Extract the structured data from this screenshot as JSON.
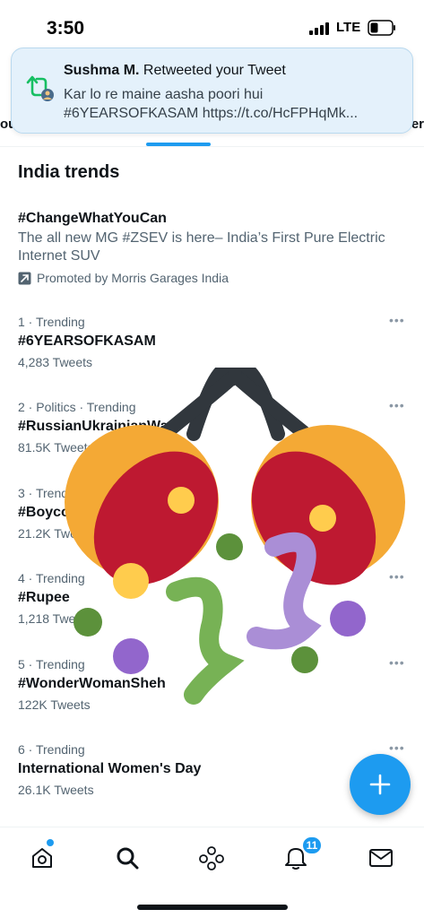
{
  "status_bar": {
    "time": "3:50",
    "network": "LTE",
    "icons": [
      "signal-icon",
      "battery-icon"
    ]
  },
  "notification": {
    "user": "Sushma M.",
    "action": "Retweeted your Tweet",
    "line1": "Kar lo re maine aasha poori hui",
    "line2": "#6YEARSOFKASAM https://t.co/HcFPHqMk...",
    "icon": "retweet-icon"
  },
  "tabs": {
    "left_edge": "ou",
    "right_edge": "er"
  },
  "section": {
    "title": "India trends"
  },
  "promoted": {
    "name": "#ChangeWhatYouCan",
    "description": "The all new MG #ZSEV is here– India’s First Pure Electric Internet SUV",
    "promoted_by": "Promoted by Morris Garages India"
  },
  "trends": [
    {
      "meta": "1 · Trending",
      "name": "#6YEARSOFKASAM",
      "count": "4,283 Tweets"
    },
    {
      "meta": "2 · Politics · Trending",
      "name": "#RussianUkrainianWar",
      "count": "81.5K Tweets"
    },
    {
      "meta": "3 · Trending",
      "name": "#Boycott",
      "count": "21.2K Tweets"
    },
    {
      "meta": "4 · Trending",
      "name": "#Rupee",
      "count": "1,218 Tweets"
    },
    {
      "meta": "5 · Trending",
      "name": "#WonderWomanSheh",
      "count": "122K Tweets"
    },
    {
      "meta": "6 · Trending",
      "name": "International Women's Day",
      "count": "26.1K Tweets"
    }
  ],
  "more_label": "•••",
  "compose": {
    "icon": "plus-icon"
  },
  "bottom_nav": {
    "items": [
      "home-icon",
      "search-icon",
      "spaces-icon",
      "notifications-icon",
      "messages-icon"
    ],
    "notification_count": "11"
  },
  "colors": {
    "accent": "#1d9bf0",
    "text_primary": "#0f1419",
    "text_secondary": "#536471"
  }
}
